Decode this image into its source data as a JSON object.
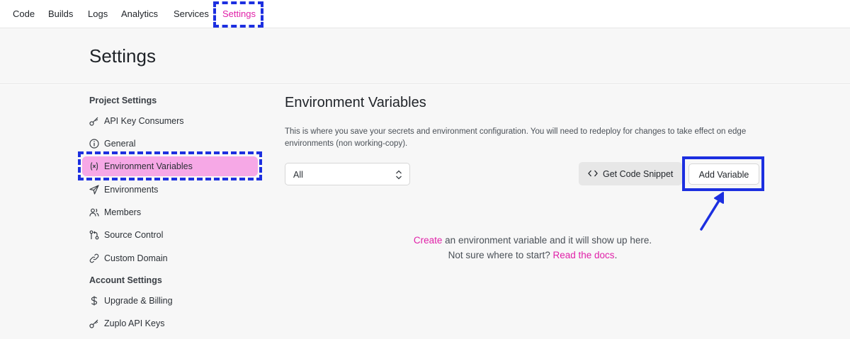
{
  "topnav": {
    "tabs": [
      {
        "label": "Code"
      },
      {
        "label": "Builds"
      },
      {
        "label": "Logs"
      },
      {
        "label": "Analytics"
      },
      {
        "label": "Services"
      },
      {
        "label": "Settings",
        "active": true
      }
    ]
  },
  "page": {
    "title": "Settings"
  },
  "sidebar": {
    "project_heading": "Project Settings",
    "project_items": [
      {
        "label": "API Key Consumers",
        "icon": "key-icon"
      },
      {
        "label": "General",
        "icon": "info-icon"
      },
      {
        "label": "Environment Variables",
        "icon": "variable-icon",
        "active": true
      },
      {
        "label": "Environments",
        "icon": "send-icon"
      },
      {
        "label": "Members",
        "icon": "members-icon"
      },
      {
        "label": "Source Control",
        "icon": "git-icon"
      },
      {
        "label": "Custom Domain",
        "icon": "link-icon"
      }
    ],
    "account_heading": "Account Settings",
    "account_items": [
      {
        "label": "Upgrade & Billing",
        "icon": "dollar-icon"
      },
      {
        "label": "Zuplo API Keys",
        "icon": "key-icon"
      }
    ]
  },
  "main": {
    "title": "Environment Variables",
    "description": "This is where you save your secrets and environment configuration. You will need to redeploy for changes to take effect on edge environments (non working-copy).",
    "filter_value": "All",
    "snippet_button": "Get Code Snippet",
    "add_button": "Add Variable",
    "empty_link": "Create",
    "empty_line1_rest": " an environment variable and it will show up here.",
    "empty_line2_prefix": "Not sure where to start? ",
    "empty_line2_link": "Read the docs",
    "empty_line2_suffix": "."
  },
  "colors": {
    "accent": "#e020a8",
    "active_bg": "#f6a8e6",
    "annotation": "#1c2fe0"
  }
}
